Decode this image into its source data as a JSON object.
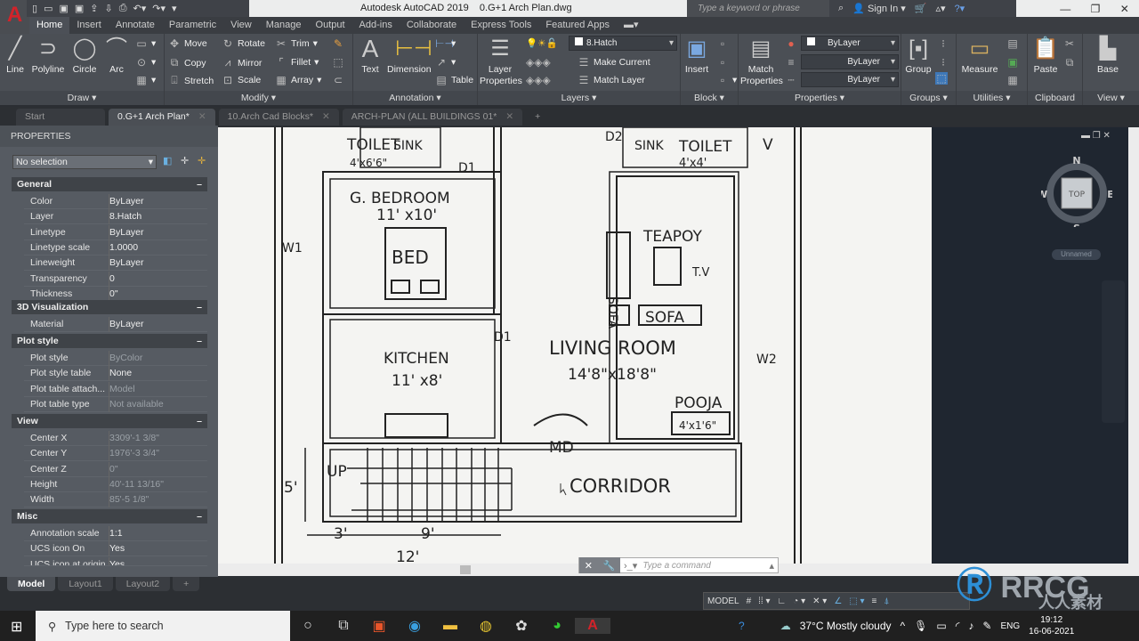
{
  "app": {
    "logo": "A",
    "title": "Autodesk AutoCAD 2019    0.G+1 Arch Plan.dwg",
    "search_placeholder": "Type a keyword or phrase",
    "sign_in": "Sign In"
  },
  "ribbon_tabs": [
    "Home",
    "Insert",
    "Annotate",
    "Parametric",
    "View",
    "Manage",
    "Output",
    "Add-ins",
    "Collaborate",
    "Express Tools",
    "Featured Apps"
  ],
  "ribbon": {
    "draw": {
      "title": "Draw",
      "line": "Line",
      "polyline": "Polyline",
      "circle": "Circle",
      "arc": "Arc"
    },
    "modify": {
      "title": "Modify",
      "move": "Move",
      "rotate": "Rotate",
      "trim": "Trim",
      "copy": "Copy",
      "mirror": "Mirror",
      "fillet": "Fillet",
      "stretch": "Stretch",
      "scale": "Scale",
      "array": "Array"
    },
    "annotation": {
      "title": "Annotation",
      "text": "Text",
      "dimension": "Dimension",
      "table": "Table"
    },
    "layers": {
      "title": "Layers",
      "layer_properties": "Layer Properties",
      "current_layer": "8.Hatch",
      "make_current": "Make Current",
      "match_layer": "Match Layer"
    },
    "block": {
      "title": "Block",
      "insert": "Insert"
    },
    "properties": {
      "title": "Properties",
      "match_properties": "Match Properties",
      "color": "ByLayer",
      "linetype": "ByLayer",
      "lineweight": "ByLayer"
    },
    "groups": {
      "title": "Groups",
      "group": "Group"
    },
    "utilities": {
      "title": "Utilities",
      "measure": "Measure"
    },
    "clipboard": {
      "title": "Clipboard",
      "paste": "Paste"
    },
    "view": {
      "title": "View",
      "base": "Base"
    }
  },
  "file_tabs": [
    {
      "label": "Start"
    },
    {
      "label": "0.G+1 Arch Plan*",
      "active": true
    },
    {
      "label": "10.Arch Cad Blocks*"
    },
    {
      "label": "ARCH-PLAN (ALL BUILDINGS  01*"
    }
  ],
  "properties": {
    "title": "PROPERTIES",
    "selection": "No selection",
    "sections": {
      "general": {
        "title": "General",
        "rows": [
          [
            "Color",
            "ByLayer"
          ],
          [
            "Layer",
            "8.Hatch"
          ],
          [
            "Linetype",
            "ByLayer"
          ],
          [
            "Linetype scale",
            "1.0000"
          ],
          [
            "Lineweight",
            "ByLayer"
          ],
          [
            "Transparency",
            "0"
          ],
          [
            "Thickness",
            "0\""
          ]
        ]
      },
      "viz": {
        "title": "3D Visualization",
        "rows": [
          [
            "Material",
            "ByLayer"
          ]
        ]
      },
      "plot": {
        "title": "Plot style",
        "rows": [
          [
            "Plot style",
            "ByColor"
          ],
          [
            "Plot style table",
            "None"
          ],
          [
            "Plot table attach...",
            "Model"
          ],
          [
            "Plot table type",
            "Not available"
          ]
        ]
      },
      "view": {
        "title": "View",
        "rows": [
          [
            "Center X",
            "3309'-1 3/8\""
          ],
          [
            "Center Y",
            "1976'-3 3/4\""
          ],
          [
            "Center Z",
            "0\""
          ],
          [
            "Height",
            "40'-11 13/16\""
          ],
          [
            "Width",
            "85'-5 1/8\""
          ]
        ]
      },
      "misc": {
        "title": "Misc",
        "rows": [
          [
            "Annotation scale",
            "1:1"
          ],
          [
            "UCS icon On",
            "Yes"
          ],
          [
            "UCS icon at origin",
            "Yes"
          ]
        ]
      }
    }
  },
  "drawing_labels": {
    "toilet1": "TOILET",
    "sink": "SINK",
    "toilet1_dim": "4'x6'6\"",
    "d2": "D2",
    "sink2": "SINK",
    "toilet2": "TOILET",
    "toilet2_dim": "4'x4'",
    "v": "V",
    "d1a": "D1",
    "gbed": "G. BEDROOM",
    "gbed_dim": "11' x10'",
    "w1": "W1",
    "bed": "BED",
    "teapoy": "TEAPOY",
    "sofa_v": "SOFA",
    "tv": "T.V",
    "sofa": "SOFA",
    "kitchen": "KITCHEN",
    "kitchen_dim": "11' x8'",
    "d1b": "D1",
    "living": "LIVING ROOM",
    "living_dim": "14'8\"x18'8\"",
    "w2": "W2",
    "pooja": "POOJA",
    "pooja_dim": "4'x1'6\"",
    "md": "MD",
    "up": "UP",
    "corridor": "CORRIDOR",
    "dim5": "5'",
    "dim3": "3'",
    "dim9": "9'",
    "dim12": "12'"
  },
  "viewcube": {
    "n": "N",
    "s": "S",
    "e": "E",
    "w": "W",
    "top": "TOP",
    "ucs": "Unnamed"
  },
  "command": {
    "placeholder": "Type a command"
  },
  "layout_tabs": [
    "Model",
    "Layout1",
    "Layout2"
  ],
  "status": {
    "model": "MODEL"
  },
  "taskbar": {
    "search": "Type here to search",
    "weather": "37°C  Mostly cloudy",
    "lang": "ENG",
    "time": "19:12",
    "date": "16-06-2021"
  },
  "watermark": {
    "brand": "RRCG",
    "sub": "人人素材"
  },
  "colors": {
    "accent": "#d2232a",
    "ribbon": "#4b4f55",
    "canvas": "#f4f4f2"
  }
}
